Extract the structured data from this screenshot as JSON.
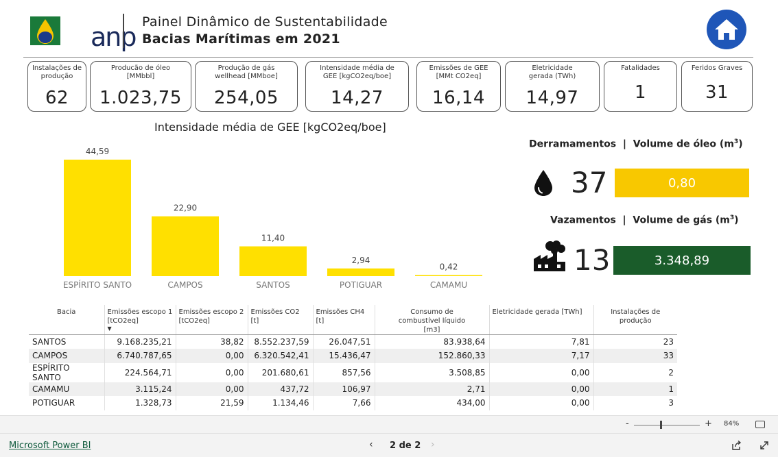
{
  "header": {
    "logo_text": "anp",
    "title_line1": "Painel Dinâmico de Sustentabilidade",
    "title_line2": "Bacias Marítimas em 2021",
    "home_icon": "home-icon"
  },
  "kpis": [
    {
      "label": "Instalações de produção",
      "value": "62"
    },
    {
      "label": "Producão de óleo [MMbbl]",
      "value": "1.023,75"
    },
    {
      "label": "Produção de gás wellhead [MMboe]",
      "value": "254,05"
    },
    {
      "label": "Intensidade média de GEE [kgCO2eq/boe]",
      "value": "14,27"
    },
    {
      "label": "Emissões de GEE [MMt CO2eq]",
      "value": "16,14"
    },
    {
      "label": "Eletricidade gerada (TWh)",
      "value": "14,97"
    },
    {
      "label": "Fatalidades",
      "value": "1"
    },
    {
      "label": "Feridos Graves",
      "value": "31"
    }
  ],
  "chart_title": "Intensidade média de GEE [kgCO2eq/boe]",
  "chart_data": {
    "type": "bar",
    "title": "Intensidade média de GEE [kgCO2eq/boe]",
    "categories": [
      "ESPÍRITO SANTO",
      "CAMPOS",
      "SANTOS",
      "POTIGUAR",
      "CAMAMU"
    ],
    "values": [
      44.59,
      22.9,
      11.4,
      2.94,
      0.42
    ],
    "value_labels": [
      "44,59",
      "22,90",
      "11,40",
      "2,94",
      "0,42"
    ],
    "color": "#ffe000",
    "ylim": [
      0,
      44.59
    ],
    "grid": false
  },
  "spills": {
    "title_left": "Derramamentos",
    "title_right": "Volume de óleo (m",
    "superscript": "3",
    "title_close": ")",
    "count": "37",
    "volume": "0,80",
    "icon": "oil-drop-icon"
  },
  "leaks": {
    "title_left": "Vazamentos",
    "title_right": "Volume de gás  (m",
    "superscript": "3",
    "title_close": ")",
    "count": "13",
    "volume": "3.348,89",
    "icon": "factory-smoke-icon"
  },
  "colors": {
    "accent_yellow": "#f8c800",
    "bar_yellow": "#ffe000",
    "green": "#1a5c2a",
    "home_blue": "#1f56b8"
  },
  "table": {
    "headers": [
      "Bacia",
      "Emissões escopo 1 [tCO2eq]",
      "Emissões escopo 2 [tCO2eq]",
      "Emissões CO2 [t]",
      "Emissões CH4 [t]",
      "Consumo de combustível líquido [m3]",
      "Eletricidade gerada [TWh]",
      "Instalações de produção"
    ],
    "sort_indicator": "▼",
    "rows": [
      [
        "SANTOS",
        "9.168.235,21",
        "38,82",
        "8.552.237,59",
        "26.047,51",
        "83.938,64",
        "7,81",
        "23"
      ],
      [
        "CAMPOS",
        "6.740.787,65",
        "0,00",
        "6.320.542,41",
        "15.436,47",
        "152.860,33",
        "7,17",
        "33"
      ],
      [
        "ESPÍRITO SANTO",
        "224.564,71",
        "0,00",
        "201.680,61",
        "857,56",
        "3.508,85",
        "0,00",
        "2"
      ],
      [
        "CAMAMU",
        "3.115,24",
        "0,00",
        "437,72",
        "106,97",
        "2,71",
        "0,00",
        "1"
      ],
      [
        "POTIGUAR",
        "1.328,73",
        "21,59",
        "1.134,46",
        "7,66",
        "434,00",
        "0,00",
        "3"
      ]
    ]
  },
  "zoom": {
    "minus": "-",
    "plus": "+",
    "percent": "84%"
  },
  "footer": {
    "brand": "Microsoft Power BI",
    "page_label": "2 de 2",
    "prev": "‹",
    "next": "›"
  }
}
